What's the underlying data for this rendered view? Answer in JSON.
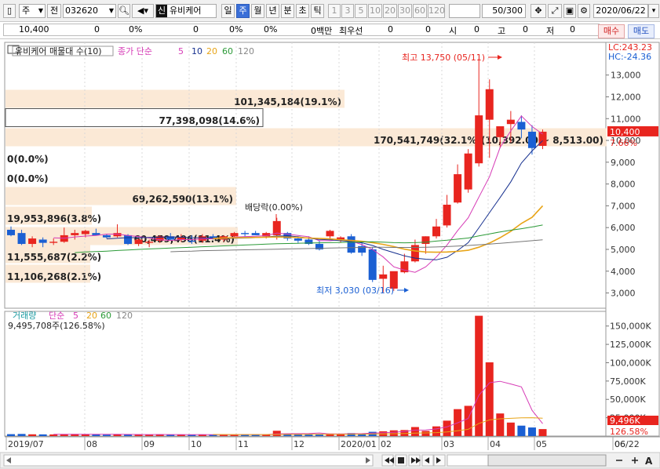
{
  "toolbar": {
    "menu_glyph": "▯",
    "market": "주",
    "prefix": "전",
    "code": "032620",
    "badge": "신",
    "name": "유비케어",
    "periods": [
      "일",
      "주",
      "월",
      "년",
      "분",
      "초",
      "틱"
    ],
    "active_period": "주",
    "intervals": [
      "1",
      "3",
      "5",
      "10",
      "20",
      "30",
      "60",
      "120"
    ],
    "count": "50/300",
    "date": "2020/06/22"
  },
  "quote": {
    "price": "10,400",
    "v1": "0",
    "v2": "0%",
    "v3": "0",
    "v4": "0%",
    "v5": "0%",
    "unit": "0백만",
    "pref_label": "최우선",
    "pref_v1": "0",
    "pref_v2": "0",
    "open_label": "시",
    "open_value": "0",
    "high_label": "고",
    "high_value": "0",
    "low_label": "저",
    "low_value": "0",
    "buy_label": "매수",
    "sell_label": "매도"
  },
  "price_panel": {
    "title": "유비케어 매물대 수(10)",
    "ma_label": "종가 단순",
    "ma_periods": [
      "5",
      "10",
      "20",
      "60",
      "120"
    ],
    "lc": "LC:243.23",
    "hc": "HC:-24.36",
    "high_note": "최고 13,750 (05/11)",
    "low_note": "최저 3,030 (03/16)",
    "dividend_note": "배당락(0.00%)",
    "current_price": "10,400",
    "current_change": "7.66%",
    "volume_profile": [
      "101,345,184(19.1%)",
      "77,398,098(14.6%)",
      "170,541,749(32.1%)(10,392.00 ~ 8,513.00)",
      "0(0.0%)",
      "0(0.0%)",
      "69,262,590(13.1%)",
      "19,953,896(3.8%)",
      "60,459,496(11.4%)",
      "11,555,687(2.2%)",
      "11,106,268(2.1%)"
    ]
  },
  "volume_panel": {
    "title": "거래량",
    "ma_label": "단순",
    "ma_periods": [
      "5",
      "20",
      "60",
      "120"
    ],
    "current": "9,495,708주(126.58%)",
    "current_short": "9,496K",
    "current_pct": "126.58%"
  },
  "colors": {
    "up": "#e8251f",
    "down": "#1a5fd3",
    "ma5": "#d63bb6",
    "ma10": "#16308f",
    "ma20": "#e8a417",
    "ma60": "#2b9a37",
    "ma120": "#777777"
  },
  "chart_data": {
    "type": "candlestick",
    "interval": "weekly",
    "x_ticks": [
      "2019/07",
      "08",
      "09",
      "10",
      "11",
      "12",
      "2020/01",
      "02",
      "03",
      "04",
      "05",
      "06",
      "06/22"
    ],
    "price_axis": {
      "ticks": [
        "13,000",
        "12,000",
        "11,000",
        "10,000",
        "9,000",
        "8,000",
        "7,000",
        "6,000",
        "5,000",
        "4,000",
        "3,000"
      ],
      "range": [
        2300,
        14500
      ]
    },
    "volume_axis": {
      "ticks": [
        "150,000K",
        "125,000K",
        "100,000K",
        "75,000K",
        "50,000K",
        "25,000K"
      ],
      "range": [
        0,
        170000
      ]
    },
    "candles": [
      {
        "o": 5900,
        "h": 6050,
        "l": 5600,
        "c": 5650
      },
      {
        "o": 5750,
        "h": 5900,
        "l": 5200,
        "c": 5250
      },
      {
        "o": 5250,
        "h": 5600,
        "l": 5100,
        "c": 5500
      },
      {
        "o": 5450,
        "h": 5550,
        "l": 5100,
        "c": 5300
      },
      {
        "o": 5300,
        "h": 5500,
        "l": 5200,
        "c": 5350
      },
      {
        "o": 5350,
        "h": 6000,
        "l": 5300,
        "c": 5650
      },
      {
        "o": 5650,
        "h": 5900,
        "l": 5450,
        "c": 5750
      },
      {
        "o": 5700,
        "h": 5900,
        "l": 5550,
        "c": 5850
      },
      {
        "o": 5750,
        "h": 5950,
        "l": 5650,
        "c": 5650
      },
      {
        "o": 5650,
        "h": 5700,
        "l": 5500,
        "c": 5550
      },
      {
        "o": 5600,
        "h": 6150,
        "l": 5550,
        "c": 5750
      },
      {
        "o": 5650,
        "h": 5700,
        "l": 5200,
        "c": 5250
      },
      {
        "o": 5250,
        "h": 5500,
        "l": 5150,
        "c": 5450
      },
      {
        "o": 5300,
        "h": 5450,
        "l": 5100,
        "c": 5350
      },
      {
        "o": 5400,
        "h": 5650,
        "l": 5300,
        "c": 5600
      },
      {
        "o": 5600,
        "h": 5750,
        "l": 5400,
        "c": 5450
      },
      {
        "o": 5450,
        "h": 5700,
        "l": 5350,
        "c": 5550
      },
      {
        "o": 5400,
        "h": 5650,
        "l": 5250,
        "c": 5350
      },
      {
        "o": 5400,
        "h": 5700,
        "l": 5300,
        "c": 5600
      },
      {
        "o": 5600,
        "h": 5700,
        "l": 5450,
        "c": 5500
      },
      {
        "o": 5450,
        "h": 5650,
        "l": 5350,
        "c": 5600
      },
      {
        "o": 5600,
        "h": 5800,
        "l": 5500,
        "c": 5750
      },
      {
        "o": 5750,
        "h": 5850,
        "l": 5600,
        "c": 5700
      },
      {
        "o": 5750,
        "h": 5850,
        "l": 5650,
        "c": 5650
      },
      {
        "o": 5600,
        "h": 5800,
        "l": 5500,
        "c": 5750
      },
      {
        "o": 5650,
        "h": 6450,
        "l": 5450,
        "c": 6300
      },
      {
        "o": 5750,
        "h": 5800,
        "l": 5400,
        "c": 5500
      },
      {
        "o": 5500,
        "h": 5600,
        "l": 5300,
        "c": 5400
      },
      {
        "o": 5450,
        "h": 5600,
        "l": 5200,
        "c": 5250
      },
      {
        "o": 5250,
        "h": 5400,
        "l": 4950,
        "c": 5000
      },
      {
        "o": 5600,
        "h": 5900,
        "l": 5450,
        "c": 5850
      },
      {
        "o": 5450,
        "h": 5600,
        "l": 5300,
        "c": 5550
      },
      {
        "o": 5600,
        "h": 5700,
        "l": 4800,
        "c": 4850
      },
      {
        "o": 5150,
        "h": 5300,
        "l": 4700,
        "c": 4850
      },
      {
        "o": 5000,
        "h": 5100,
        "l": 3500,
        "c": 3600
      },
      {
        "o": 3650,
        "h": 4250,
        "l": 3030,
        "c": 3850
      },
      {
        "o": 3200,
        "h": 3950,
        "l": 3100,
        "c": 4000
      },
      {
        "o": 3950,
        "h": 4800,
        "l": 3900,
        "c": 4450
      },
      {
        "o": 4450,
        "h": 5450,
        "l": 4400,
        "c": 5200
      },
      {
        "o": 5250,
        "h": 5600,
        "l": 4800,
        "c": 5600
      },
      {
        "o": 5600,
        "h": 6400,
        "l": 5500,
        "c": 6050
      },
      {
        "o": 6100,
        "h": 7500,
        "l": 6000,
        "c": 7050
      },
      {
        "o": 7150,
        "h": 8900,
        "l": 7100,
        "c": 8450
      },
      {
        "o": 7750,
        "h": 9600,
        "l": 7600,
        "c": 9400
      },
      {
        "o": 8950,
        "h": 13750,
        "l": 8800,
        "c": 11150
      },
      {
        "o": 10950,
        "h": 12800,
        "l": 9200,
        "c": 12350
      },
      {
        "o": 10150,
        "h": 10400,
        "l": 9650,
        "c": 10650
      },
      {
        "o": 10750,
        "h": 11350,
        "l": 9900,
        "c": 10950
      },
      {
        "o": 10850,
        "h": 11150,
        "l": 10100,
        "c": 10500
      },
      {
        "o": 10400,
        "h": 10700,
        "l": 9350,
        "c": 9650
      },
      {
        "o": 9750,
        "h": 10500,
        "l": 9600,
        "c": 10400
      }
    ],
    "ma": {
      "ma5": [
        null,
        null,
        null,
        null,
        5530,
        5510,
        5570,
        5610,
        5640,
        5700,
        5700,
        5640,
        5590,
        5520,
        5440,
        5410,
        5450,
        5450,
        5480,
        5490,
        5510,
        5560,
        5590,
        5600,
        5630,
        5750,
        5700,
        5640,
        5580,
        5400,
        5400,
        5450,
        5380,
        5220,
        5000,
        4650,
        4200,
        4050,
        3950,
        4200,
        4650,
        5200,
        5860,
        6450,
        7400,
        8340,
        9680,
        10440,
        11120,
        10640,
        10290
      ],
      "ma10": [
        null,
        null,
        null,
        null,
        null,
        null,
        null,
        null,
        null,
        5480,
        5510,
        5540,
        5540,
        5550,
        5560,
        5570,
        5560,
        5540,
        5530,
        5520,
        5500,
        5510,
        5520,
        5540,
        5570,
        5610,
        5620,
        5580,
        5510,
        5460,
        5440,
        5400,
        5360,
        5300,
        5180,
        5000,
        4850,
        4700,
        4600,
        4550,
        4520,
        4640,
        4950,
        5310,
        5990,
        6690,
        7380,
        8100,
        8960,
        9520,
        9990
      ],
      "ma20": [
        null,
        null,
        null,
        null,
        null,
        null,
        null,
        null,
        null,
        null,
        null,
        null,
        null,
        null,
        null,
        null,
        null,
        null,
        null,
        5500,
        5520,
        5530,
        5540,
        5550,
        5560,
        5570,
        5560,
        5550,
        5520,
        5500,
        5480,
        5440,
        5410,
        5370,
        5310,
        5230,
        5130,
        5010,
        4930,
        4880,
        4870,
        4880,
        4910,
        4960,
        5100,
        5290,
        5540,
        5830,
        6190,
        6470,
        7000
      ],
      "ma60": [
        null,
        null,
        null,
        null,
        null,
        null,
        4850,
        4880,
        4900,
        4920,
        4950,
        4970,
        5000,
        5020,
        5040,
        5060,
        5080,
        5100,
        5120,
        5140,
        5160,
        5180,
        5200,
        5220,
        5240,
        5260,
        5270,
        5280,
        5290,
        5300,
        5310,
        5320,
        5330,
        5340,
        5350,
        5330,
        5310,
        5300,
        5310,
        5330,
        5380,
        5420,
        5470,
        5520,
        5620,
        5710,
        5800,
        5880,
        5950,
        6030,
        6120
      ],
      "ma120": [
        null,
        null,
        null,
        null,
        null,
        null,
        null,
        null,
        null,
        null,
        null,
        null,
        null,
        null,
        null,
        4890,
        4910,
        4920,
        4940,
        4950,
        4960,
        4970,
        4980,
        4990,
        5000,
        5010,
        5020,
        5030,
        5040,
        5050,
        5060,
        5070,
        5080,
        5090,
        5100,
        5100,
        5090,
        5090,
        5090,
        5100,
        5110,
        5130,
        5150,
        5180,
        5210,
        5240,
        5280,
        5320,
        5360,
        5400,
        5440
      ]
    },
    "volumes": [
      2600,
      2900,
      2400,
      2300,
      2200,
      2500,
      2800,
      2300,
      2100,
      1900,
      2600,
      2200,
      1800,
      1700,
      2500,
      2000,
      1900,
      1800,
      2100,
      1900,
      1800,
      2100,
      2300,
      1900,
      2000,
      7200,
      3100,
      2400,
      2500,
      2600,
      3400,
      3200,
      4000,
      3300,
      5800,
      6500,
      7800,
      8200,
      12300,
      7000,
      13200,
      21000,
      36700,
      41200,
      164000,
      100500,
      30800,
      18400,
      14200,
      11700,
      9496
    ],
    "volume_ma5": [
      null,
      null,
      null,
      null,
      2480,
      2460,
      2420,
      2420,
      2380,
      2320,
      2340,
      2220,
      2120,
      2060,
      2160,
      2040,
      1980,
      1940,
      2060,
      1940,
      1920,
      1940,
      2040,
      2000,
      2020,
      3000,
      3260,
      3340,
      3460,
      4160,
      2800,
      2840,
      3100,
      3300,
      3940,
      4560,
      5280,
      6320,
      8120,
      8360,
      9700,
      12460,
      18040,
      23980,
      55620,
      72680,
      74640,
      71020,
      67020,
      35120,
      16930
    ],
    "volume_ma20": [
      null,
      null,
      null,
      null,
      null,
      null,
      null,
      null,
      null,
      null,
      null,
      null,
      null,
      null,
      null,
      null,
      null,
      null,
      null,
      2140,
      2090,
      2070,
      2050,
      2030,
      2020,
      2260,
      2280,
      2290,
      2320,
      2350,
      2400,
      2450,
      2550,
      2610,
      2770,
      2990,
      3260,
      3540,
      4060,
      4280,
      4740,
      5600,
      7270,
      9170,
      17240,
      22030,
      23520,
      24210,
      24800,
      25050,
      24350
    ]
  }
}
